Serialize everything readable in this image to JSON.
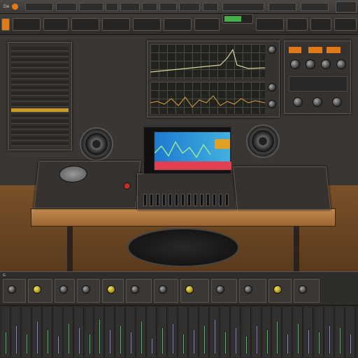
{
  "menubar": {
    "items": [
      "De",
      "",
      "",
      "",
      "",
      "",
      "",
      "",
      "",
      "",
      "",
      "",
      ""
    ]
  },
  "toolbar": {
    "master_level": 0.62
  },
  "left_panel": {
    "rows": 18,
    "highlight_row": 11
  },
  "scope": {
    "label": ""
  },
  "right_panel": {
    "orange_buttons": 3
  },
  "mixer": {
    "channel_count": 34,
    "fader_levels": [
      0.55,
      0.7,
      0.5,
      0.8,
      0.6,
      0.45,
      0.75,
      0.65,
      0.5,
      0.85,
      0.6,
      0.7,
      0.55,
      0.8,
      0.4,
      0.65,
      0.75,
      0.5,
      0.6,
      0.7,
      0.85,
      0.55,
      0.65,
      0.45,
      0.7,
      0.6,
      0.8,
      0.5,
      0.75,
      0.6,
      0.55,
      0.7,
      0.65,
      0.5
    ]
  },
  "bottom_strip": {
    "label": "G"
  },
  "laptop": {
    "screen_caption": ""
  },
  "colors": {
    "accent": "#e07a16",
    "meter": "#43b04a",
    "background": "#2a2826",
    "wood": "#b07a42"
  }
}
